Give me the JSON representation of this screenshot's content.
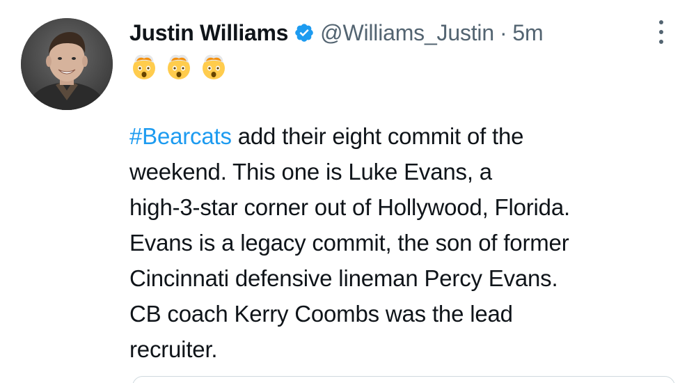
{
  "tweet": {
    "author": {
      "display_name": "Justin Williams",
      "handle": "@Williams_Justin",
      "verified": true,
      "avatar": "profile-photo"
    },
    "separator": "·",
    "timestamp": "5m",
    "emoji_line": [
      "exploding-head",
      "exploding-head",
      "exploding-head"
    ],
    "body": {
      "hashtag": "#Bearcats",
      "lines": [
        " add their eight commit of the",
        "weekend. This one is Luke Evans, a",
        "high-3-star corner out of Hollywood, Florida.",
        "Evans is a legacy commit, the son of former",
        "Cincinnati defensive lineman Percy Evans.",
        "CB coach Kerry Coombs was the lead",
        "recruiter."
      ]
    }
  },
  "colors": {
    "text": "#0f1419",
    "secondary": "#536471",
    "link": "#1d9bf0",
    "verified_badge": "#1d9bf0",
    "border": "#cfd9de"
  },
  "icons": {
    "verified": "verified-badge-icon",
    "more": "more-options-icon"
  }
}
